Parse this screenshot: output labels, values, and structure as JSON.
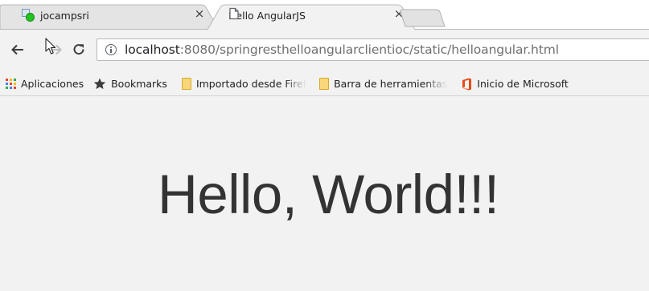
{
  "tabs": [
    {
      "title": "jocampsri",
      "close": "×",
      "active": false,
      "favicon": "green-dot-favicon-icon"
    },
    {
      "title": "Hello AngularJS",
      "close": "×",
      "active": true,
      "favicon": "page-icon"
    }
  ],
  "toolbar": {
    "url_host": "localhost",
    "url_rest": ":8080/springresthelloangularclientioc/static/helloangular.html",
    "back_icon": "back-arrow-icon",
    "forward_icon": "forward-arrow-icon",
    "reload_icon": "reload-icon",
    "info_icon": "info-icon"
  },
  "bookmarks": [
    {
      "label": "Aplicaciones",
      "icon": "apps-grid-icon"
    },
    {
      "label": "Bookmarks",
      "icon": "star-icon"
    },
    {
      "label": "Importado desde Firef",
      "icon": "folder-icon"
    },
    {
      "label": "Barra de herramientas",
      "icon": "folder-icon"
    },
    {
      "label": "Inicio de Microsoft",
      "icon": "office-icon"
    }
  ],
  "page": {
    "heading": "Hello, World!!!"
  },
  "colors": {
    "page_background": "#f2f2f2",
    "heading_text": "#333333",
    "url_host": "#202124",
    "url_path": "#6f6f6f",
    "favicon_green": "#21c521",
    "folder": "#f9d67a",
    "office_orange": "#e84a18"
  }
}
